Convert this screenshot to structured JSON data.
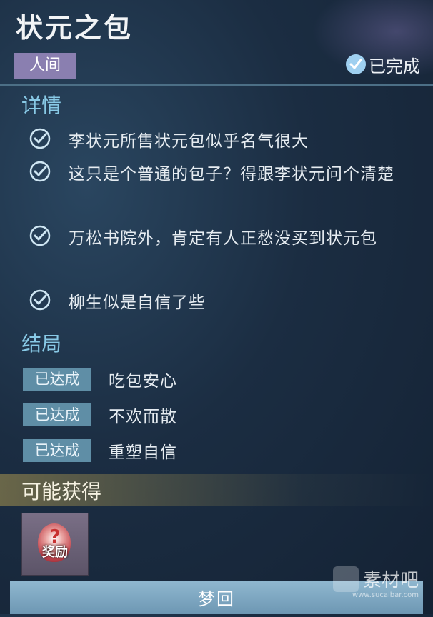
{
  "quest": {
    "title": "状元之包",
    "tag": "人间",
    "status": "已完成"
  },
  "details": {
    "heading": "详情",
    "items": [
      "李状元所售状元包似乎名气很大",
      "这只是个普通的包子？得跟李状元问个清楚",
      "万松书院外，肯定有人正愁没买到状元包",
      "柳生似是自信了些"
    ]
  },
  "endings": {
    "heading": "结局",
    "items": [
      {
        "badge": "已达成",
        "name": "吃包安心"
      },
      {
        "badge": "已达成",
        "name": "不欢而散"
      },
      {
        "badge": "已达成",
        "name": "重塑自信"
      }
    ]
  },
  "rewards": {
    "heading": "可能获得",
    "item_label": "奖励"
  },
  "action": {
    "button_label": "梦回"
  },
  "watermark": {
    "name": "素材吧",
    "url": "www.sucaibar.com"
  },
  "colors": {
    "accent": "#88c9e6",
    "tag": "#8a7fb0",
    "badge": "#5f8ea6"
  },
  "icons": {
    "status": "check-circle-icon",
    "item": "check-icon",
    "reward": "reward-gem-icon"
  }
}
